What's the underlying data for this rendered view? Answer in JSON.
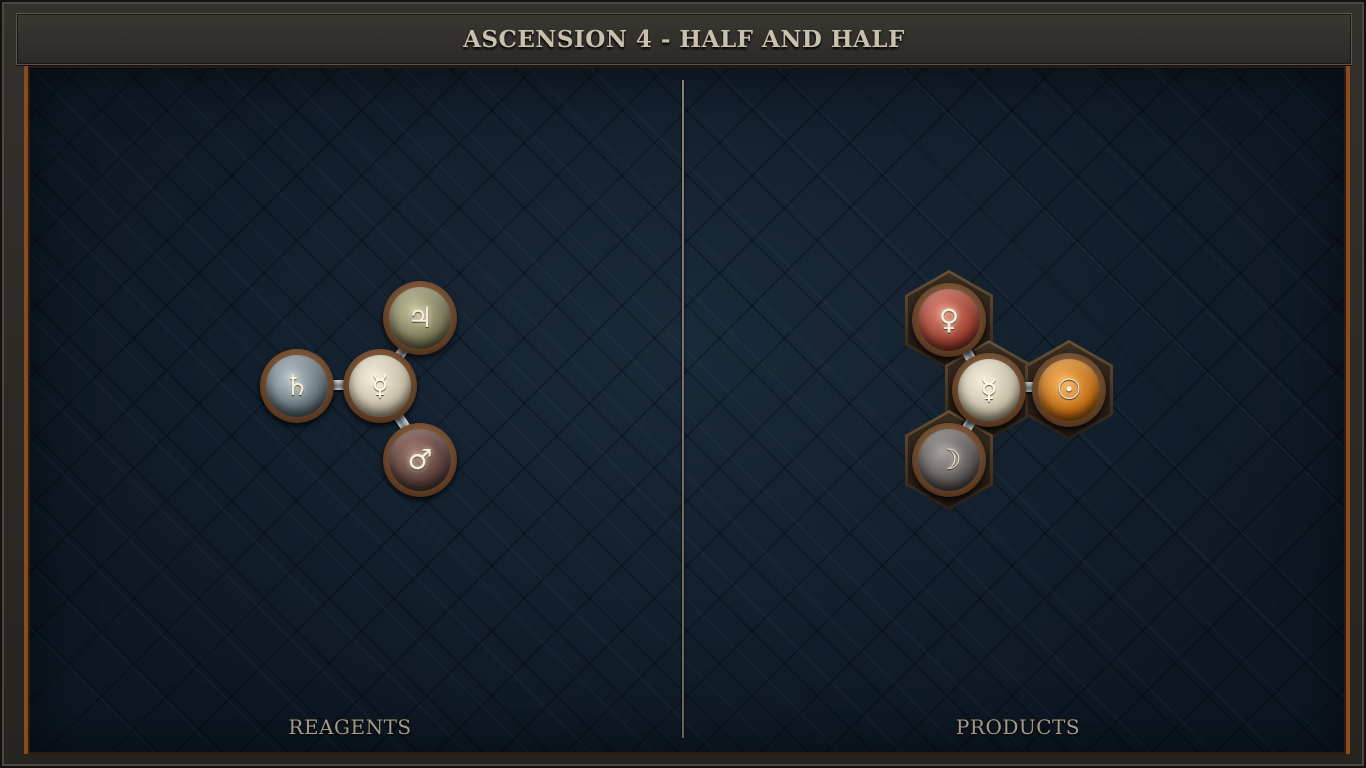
{
  "title": "ASCENSION 4 - HALF AND HALF",
  "panels": {
    "reagents_label": "REAGENTS",
    "products_label": "PRODUCTS"
  },
  "reagent_molecule": {
    "atoms": [
      {
        "id": "lead",
        "element": "lead",
        "symbol": "♄",
        "color": "#7f8c92"
      },
      {
        "id": "quicksilver",
        "element": "quicksilver",
        "symbol": "☿",
        "color": "#ddd6c4"
      },
      {
        "id": "tin",
        "element": "tin",
        "symbol": "♃",
        "color": "#8c8a6c"
      },
      {
        "id": "iron",
        "element": "iron",
        "symbol": "♂",
        "color": "#6b4a44"
      }
    ]
  },
  "product_molecule": {
    "atoms": [
      {
        "id": "copper",
        "element": "copper",
        "symbol": "♀",
        "color": "#a0483a"
      },
      {
        "id": "quicksilver",
        "element": "quicksilver",
        "symbol": "☿",
        "color": "#ddd6c4"
      },
      {
        "id": "gold",
        "element": "gold",
        "symbol": "☉",
        "color": "#c9781e"
      },
      {
        "id": "silver",
        "element": "silver",
        "symbol": "☽",
        "color": "#6a6664"
      }
    ]
  },
  "colors": {
    "board": "#0f1a26",
    "frame_accent": "#8a4a22",
    "title_text": "#c9c0ad",
    "label_text": "#a49a88"
  }
}
